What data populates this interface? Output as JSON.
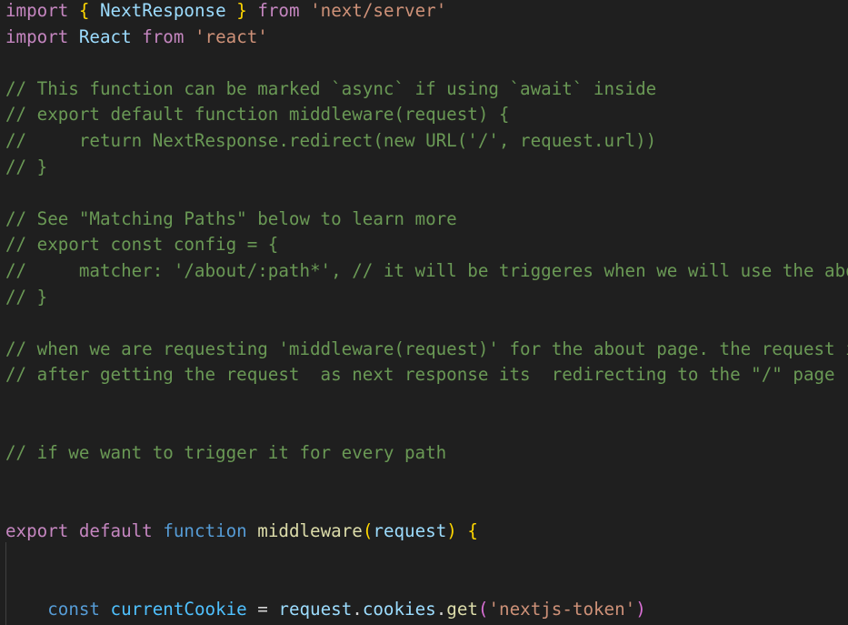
{
  "colors": {
    "background": "#1f1f1f",
    "keyword": "#c586c0",
    "declaration": "#569cd6",
    "variable": "#9cdcfe",
    "constant": "#4fc1ff",
    "function": "#dcdcaa",
    "string": "#ce9178",
    "comment": "#6a9955",
    "bracket_level_1": "#ffd700",
    "bracket_level_2": "#da70d6",
    "plain": "#d4d4d4"
  },
  "code": {
    "lines": [
      [
        [
          "keyword",
          "import"
        ],
        [
          "plain",
          " "
        ],
        [
          "brace1",
          "{"
        ],
        [
          "plain",
          " "
        ],
        [
          "var",
          "NextResponse"
        ],
        [
          "plain",
          " "
        ],
        [
          "brace1",
          "}"
        ],
        [
          "plain",
          " "
        ],
        [
          "keyword",
          "from"
        ],
        [
          "plain",
          " "
        ],
        [
          "str",
          "'next/server'"
        ]
      ],
      [
        [
          "keyword",
          "import"
        ],
        [
          "plain",
          " "
        ],
        [
          "var",
          "React"
        ],
        [
          "plain",
          " "
        ],
        [
          "keyword",
          "from"
        ],
        [
          "plain",
          " "
        ],
        [
          "str",
          "'react'"
        ]
      ],
      [],
      [
        [
          "comment",
          "// This function can be marked `async` if using `await` inside"
        ]
      ],
      [
        [
          "comment",
          "// export default function middleware(request) {"
        ]
      ],
      [
        [
          "comment",
          "//     return NextResponse.redirect(new URL('/', request.url))"
        ]
      ],
      [
        [
          "comment",
          "// }"
        ]
      ],
      [],
      [
        [
          "comment",
          "// See \"Matching Paths\" below to learn more"
        ]
      ],
      [
        [
          "comment",
          "// export const config = {"
        ]
      ],
      [
        [
          "comment",
          "//     matcher: '/about/:path*', // it will be triggeres when we will use the abo"
        ]
      ],
      [
        [
          "comment",
          "// }"
        ]
      ],
      [],
      [
        [
          "comment",
          "// when we are requesting 'middleware(request)' for the about page. the request i"
        ]
      ],
      [
        [
          "comment",
          "// after getting the request  as next response its  redirecting to the \"/\" page"
        ]
      ],
      [],
      [],
      [
        [
          "comment",
          "// if we want to trigger it for every path"
        ]
      ],
      [],
      [],
      [
        [
          "keyword",
          "export"
        ],
        [
          "plain",
          " "
        ],
        [
          "keyword",
          "default"
        ],
        [
          "plain",
          " "
        ],
        [
          "decl",
          "function"
        ],
        [
          "plain",
          " "
        ],
        [
          "fn",
          "middleware"
        ],
        [
          "brace1",
          "("
        ],
        [
          "var",
          "request"
        ],
        [
          "brace1",
          ")"
        ],
        [
          "plain",
          " "
        ],
        [
          "brace1",
          "{"
        ]
      ],
      [],
      [],
      [
        [
          "plain",
          "    "
        ],
        [
          "decl",
          "const"
        ],
        [
          "plain",
          " "
        ],
        [
          "const",
          "currentCookie"
        ],
        [
          "plain",
          " = "
        ],
        [
          "var",
          "request"
        ],
        [
          "plain",
          "."
        ],
        [
          "var",
          "cookies"
        ],
        [
          "plain",
          "."
        ],
        [
          "fn",
          "get"
        ],
        [
          "brace2",
          "("
        ],
        [
          "str",
          "'nextjs-token'"
        ],
        [
          "brace2",
          ")"
        ]
      ]
    ]
  }
}
